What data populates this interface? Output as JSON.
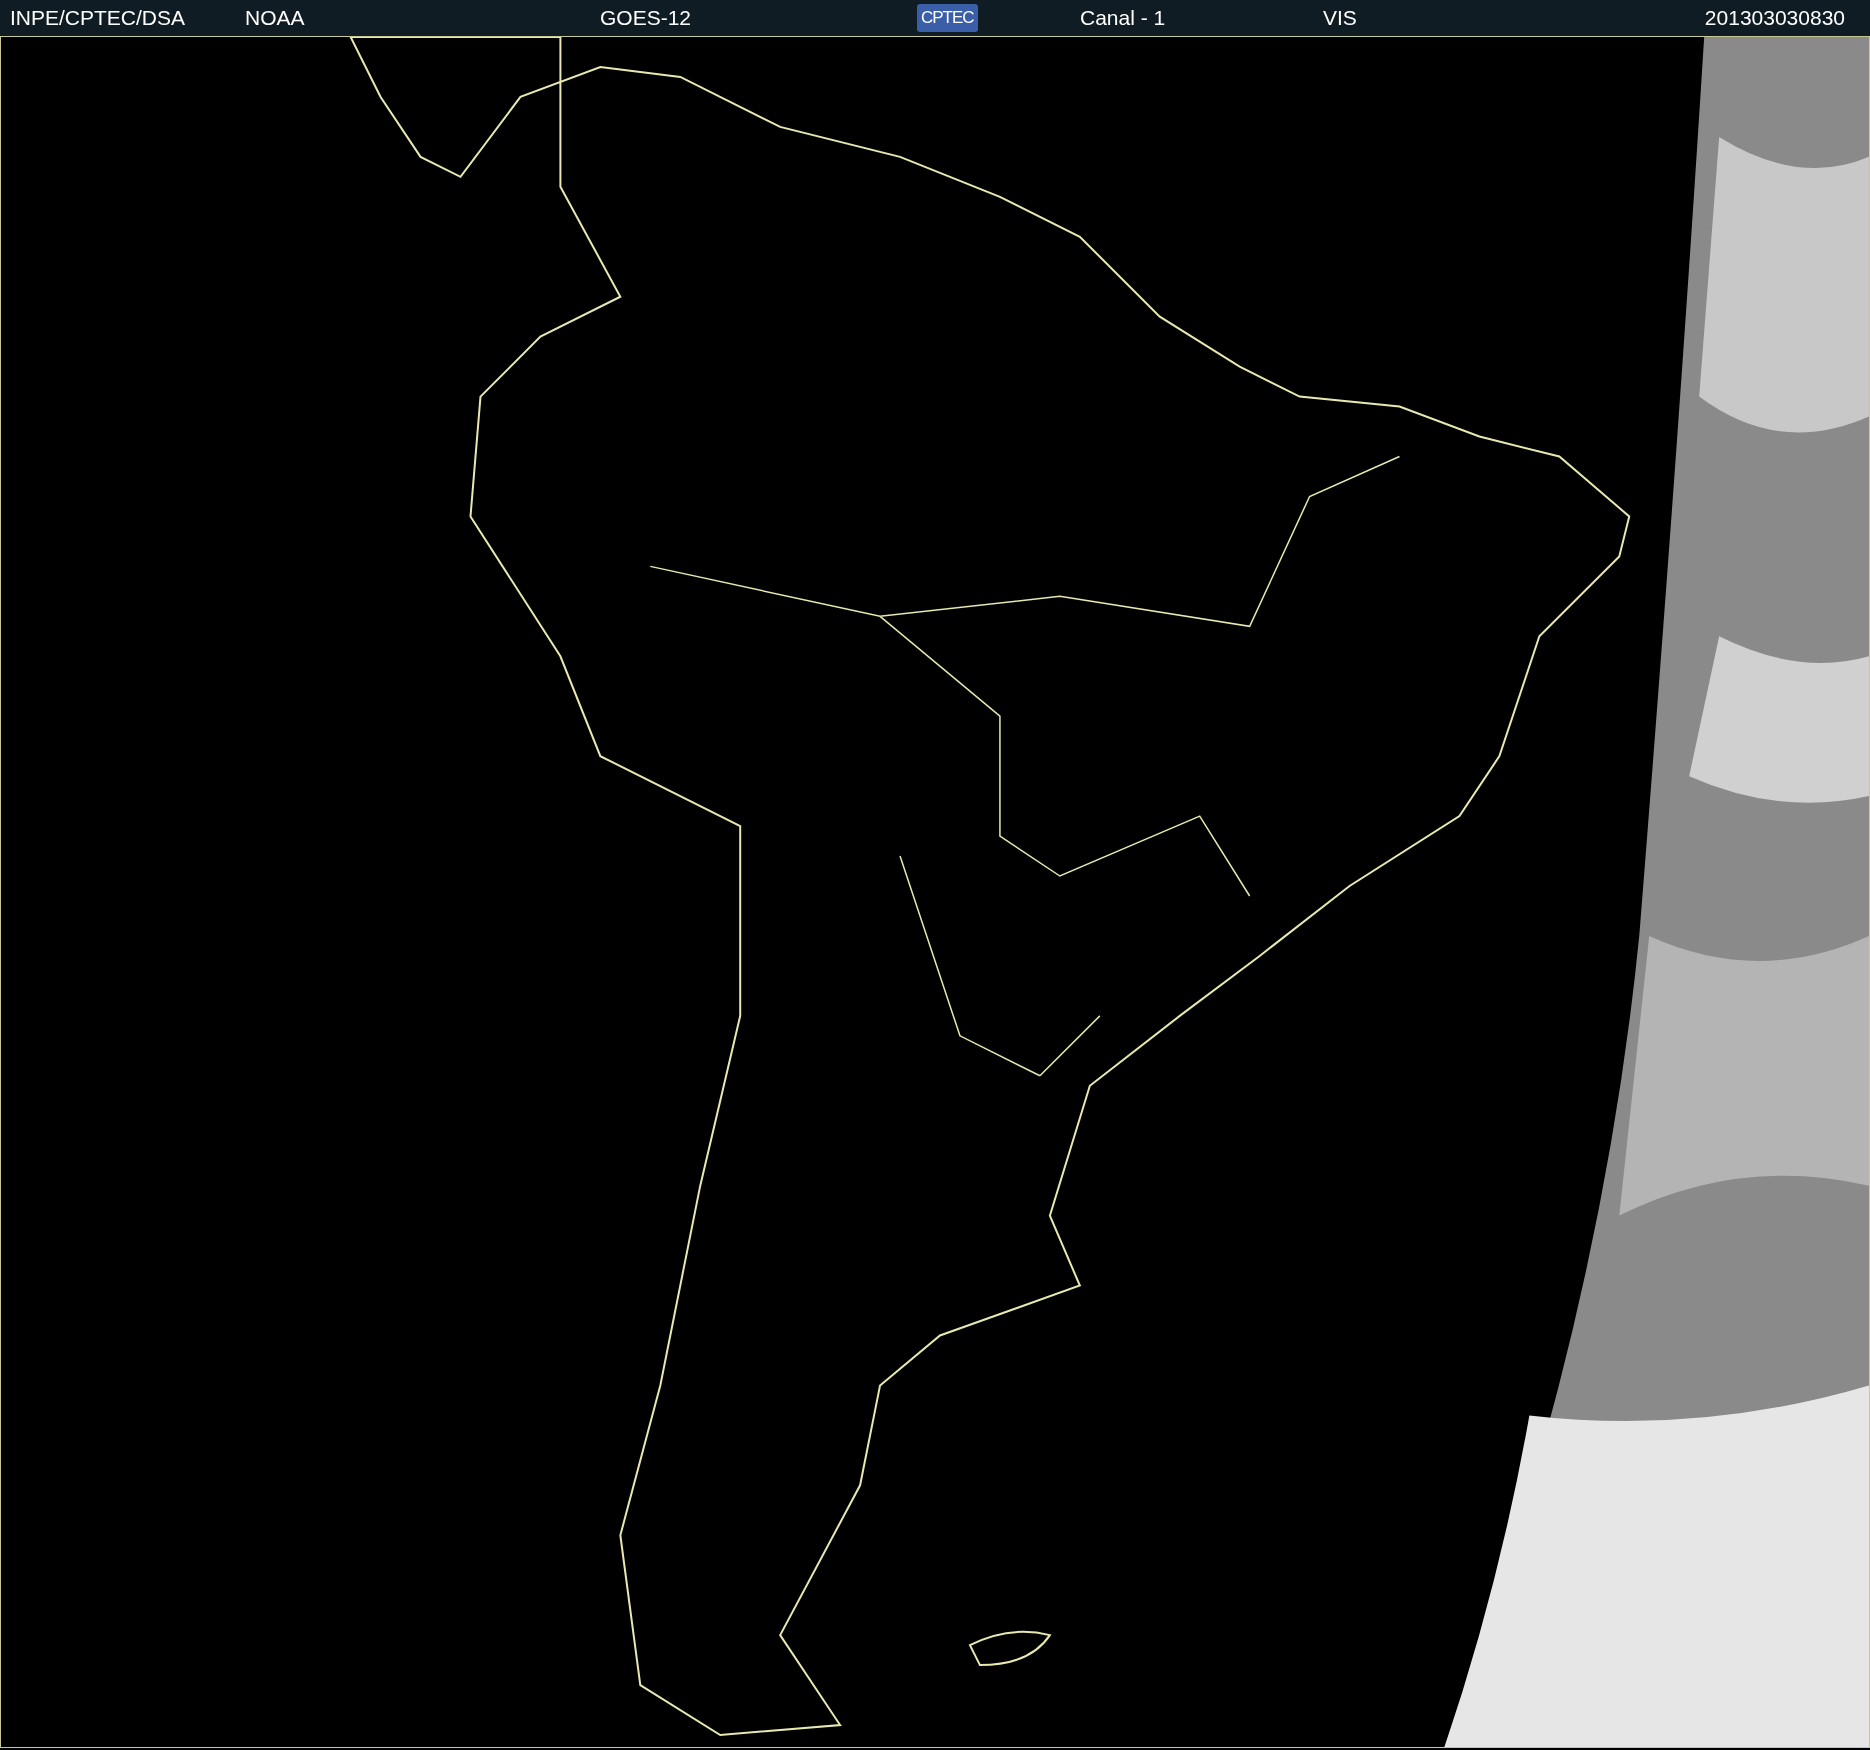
{
  "header": {
    "items": [
      {
        "kind": "text",
        "text": "INPE/CPTEC/DSA"
      },
      {
        "kind": "text",
        "text": "NOAA"
      },
      {
        "kind": "text",
        "text": "GOES-12"
      },
      {
        "kind": "logo",
        "text": "CPTEC"
      },
      {
        "kind": "text",
        "text": "Canal - 1"
      },
      {
        "kind": "text",
        "text": "VIS"
      },
      {
        "kind": "text",
        "text": "201303030830"
      }
    ]
  }
}
